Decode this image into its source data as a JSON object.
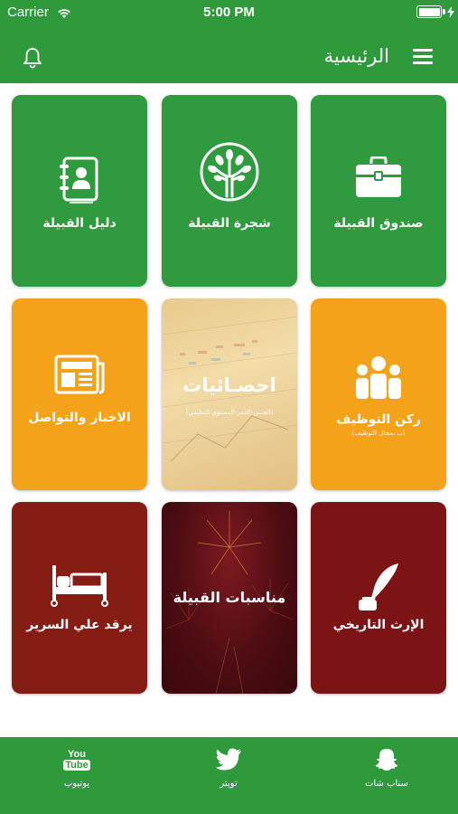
{
  "status_bar": {
    "carrier": "Carrier",
    "time": "5:00 PM",
    "battery_percent": 100
  },
  "header": {
    "title": "الرئيسية"
  },
  "tiles": [
    {
      "label": "صندوق القبيلة",
      "sub": "",
      "icon": "briefcase-icon",
      "color": "#2f9a3e"
    },
    {
      "label": "شجرة القبيلة",
      "sub": "",
      "icon": "tree-icon",
      "color": "#2f9a3e"
    },
    {
      "label": "دليل القبيلة",
      "sub": "",
      "icon": "address-book-icon",
      "color": "#2f9a3e"
    },
    {
      "label": "ركن التوظيف",
      "sub": "(ب بمجال التوظيف)",
      "icon": "people-icon",
      "color": "#f4a219"
    },
    {
      "label": "احصـائيات",
      "sub": "(الجنس-العمر-المستوي التعليمي)",
      "icon": "chart-icon",
      "color": "#e8c98a"
    },
    {
      "label": "الاخبار والتواصل",
      "sub": "",
      "icon": "newspaper-icon",
      "color": "#f4a219"
    },
    {
      "label": "الإرث التاريخي",
      "sub": "",
      "icon": "quill-icon",
      "color": "#7c1416"
    },
    {
      "label": "مناسبات القبيلة",
      "sub": "",
      "icon": "fireworks-icon",
      "color": "#4a0c12"
    },
    {
      "label": "يرقد علي السرير",
      "sub": "",
      "icon": "bed-icon",
      "color": "#851d14"
    }
  ],
  "tabbar": {
    "youtube": {
      "label": "يوتيوب",
      "icon_text_top": "You",
      "icon_text_bottom": "Tube"
    },
    "twitter": {
      "label": "تويتر"
    },
    "snapchat": {
      "label": "سناب شات"
    }
  },
  "colors": {
    "primary_green": "#2e9a3c",
    "orange": "#f4a219",
    "dark_red": "#851d14"
  }
}
